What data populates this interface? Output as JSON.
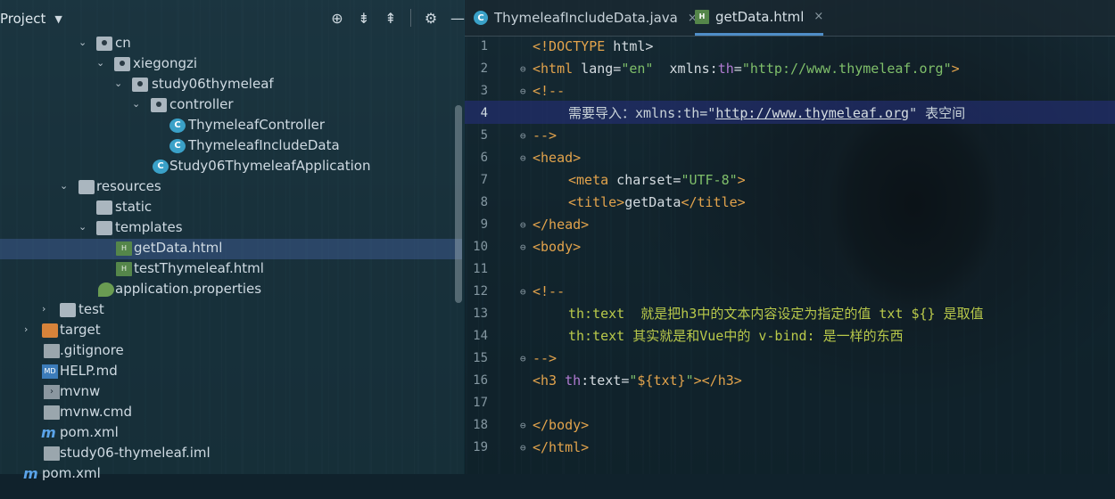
{
  "project_panel": {
    "title": "Project",
    "toolbar_icons": [
      "target-icon",
      "expand-all-icon",
      "collapse-all-icon",
      "gear-icon",
      "minimize-icon"
    ],
    "tree": [
      {
        "label": "cn",
        "icon": "package-folder-icon",
        "expanded": true
      },
      {
        "label": "xiegongzi",
        "icon": "package-folder-icon",
        "expanded": true
      },
      {
        "label": "study06thymeleaf",
        "icon": "package-folder-icon",
        "expanded": true
      },
      {
        "label": "controller",
        "icon": "package-folder-icon",
        "expanded": true
      },
      {
        "label": "ThymeleafController",
        "icon": "java-class-icon"
      },
      {
        "label": "ThymeleafIncludeData",
        "icon": "java-class-icon"
      },
      {
        "label": "Study06ThymeleafApplication",
        "icon": "spring-boot-class-icon"
      },
      {
        "label": "resources",
        "icon": "resources-folder-icon",
        "expanded": true
      },
      {
        "label": "static",
        "icon": "folder-icon"
      },
      {
        "label": "templates",
        "icon": "folder-icon",
        "expanded": true
      },
      {
        "label": "getData.html",
        "icon": "html-file-icon",
        "selected": true
      },
      {
        "label": "testThymeleaf.html",
        "icon": "html-file-icon"
      },
      {
        "label": "application.properties",
        "icon": "spring-config-icon"
      },
      {
        "label": "test",
        "icon": "folder-icon",
        "expanded": false
      },
      {
        "label": "target",
        "icon": "excluded-folder-icon",
        "expanded": false
      },
      {
        "label": ".gitignore",
        "icon": "gitignore-file-icon"
      },
      {
        "label": "HELP.md",
        "icon": "markdown-file-icon"
      },
      {
        "label": "mvnw",
        "icon": "terminal-file-icon"
      },
      {
        "label": "mvnw.cmd",
        "icon": "text-file-icon"
      },
      {
        "label": "pom.xml",
        "icon": "maven-icon"
      },
      {
        "label": "study06-thymeleaf.iml",
        "icon": "text-file-icon"
      },
      {
        "label": "pom.xml",
        "icon": "maven-icon"
      }
    ]
  },
  "editor": {
    "tabs": [
      {
        "label": "ThymeleafIncludeData.java",
        "icon": "java-class-icon",
        "active": false
      },
      {
        "label": "getData.html",
        "icon": "html-file-icon",
        "active": true
      }
    ],
    "current_line": 4,
    "line_numbers": [
      "1",
      "2",
      "3",
      "4",
      "5",
      "6",
      "7",
      "8",
      "9",
      "10",
      "11",
      "12",
      "13",
      "14",
      "15",
      "16",
      "17",
      "18",
      "19"
    ],
    "code": {
      "l1_open": "<!DOCTYPE",
      "l1_rest": " html>",
      "l2_tag": "<html",
      "l2_attr1": " lang=",
      "l2_val1": "\"en\"",
      "l2_ns": "  xmlns:",
      "l2_th": "th",
      "l2_eq": "=",
      "l2_val2": "\"http://www.thymeleaf.org\"",
      "l2_close": ">",
      "l3": "<!--",
      "l4_a": "需要导入：xmlns:th=\"",
      "l4_url": "http://www.thymeleaf.org",
      "l4_b": "\" 表空间",
      "l5": "-->",
      "l6": "<head>",
      "l7_tag": "<meta",
      "l7_attr": " charset=",
      "l7_val": "\"UTF-8\"",
      "l7_close": ">",
      "l8_open": "<title>",
      "l8_text": "getData",
      "l8_close": "</title>",
      "l9": "</head>",
      "l10": "<body>",
      "l12": "<!--",
      "l13": "th:text  就是把h3中的文本内容设定为指定的值 txt ${} 是取值",
      "l14": "th:text 其实就是和Vue中的 v-bind: 是一样的东西",
      "l15": "-->",
      "l16_tag": "<h3",
      "l16_th": " th",
      "l16_attr": ":text=",
      "l16_q1": "\"",
      "l16_expr": "${txt}",
      "l16_q2": "\"",
      "l16_close": "></h3>",
      "l18": "</body>",
      "l19": "</html>"
    }
  }
}
